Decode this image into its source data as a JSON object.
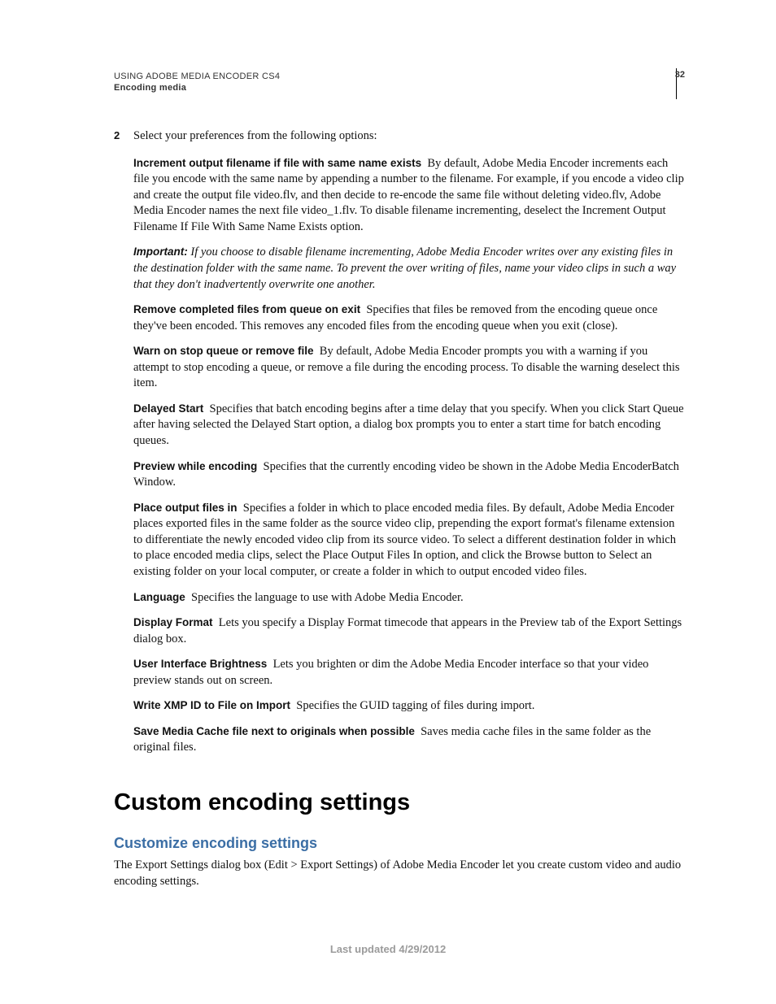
{
  "header": {
    "title": "USING ADOBE MEDIA ENCODER CS4",
    "subtitle": "Encoding media",
    "page_number": "32"
  },
  "step": {
    "number": "2",
    "text": "Select your preferences from the following options:"
  },
  "items": {
    "increment": {
      "term": "Increment output filename if file with same name exists",
      "body": "By default, Adobe Media Encoder increments each file you encode with the same name by appending a number to the filename. For example, if you encode a video clip and create the output file video.flv, and then decide to re-encode the same file without deleting video.flv, Adobe Media Encoder names the next file video_1.flv. To disable filename incrementing, deselect the Increment Output Filename If File With Same Name Exists option."
    },
    "important": {
      "lead": "Important:",
      "body": "If you choose to disable filename incrementing, Adobe Media Encoder writes over any existing files in the destination folder with the same name. To prevent the over writing of files, name your video clips in such a way that they don't inadvertently overwrite one another."
    },
    "remove": {
      "term": "Remove completed files from queue on exit",
      "body": "Specifies that files be removed from the encoding queue once they've been encoded. This removes any encoded files from the encoding queue when you exit (close)."
    },
    "warn": {
      "term": "Warn on stop queue or remove file",
      "body": "By default, Adobe Media Encoder prompts you with a warning if you attempt to stop encoding a queue, or remove a file during the encoding process. To disable the warning deselect this item."
    },
    "delayed": {
      "term": "Delayed Start",
      "body": "Specifies that batch encoding begins after a time delay that you specify. When you click Start Queue after having selected the Delayed Start option, a dialog box prompts you to enter a start time for batch encoding queues."
    },
    "preview": {
      "term": "Preview while encoding",
      "body": "Specifies that the currently encoding video be shown in the Adobe Media EncoderBatch Window."
    },
    "place": {
      "term": "Place output files in",
      "body": "Specifies a folder in which to place encoded media files. By default, Adobe Media Encoder places exported files in the same folder as the source video clip, prepending the export format's filename extension to differentiate the newly encoded video clip from its source video. To select a different destination folder in which to place encoded media clips, select the Place Output Files In option, and click the Browse button to Select an existing folder on your local computer, or create a folder in which to output encoded video files."
    },
    "language": {
      "term": "Language",
      "body": "Specifies the language to use with Adobe Media Encoder."
    },
    "display": {
      "term": "Display Format",
      "body": "Lets you specify a Display Format timecode that appears in the Preview tab of the Export Settings dialog box."
    },
    "brightness": {
      "term": "User Interface Brightness",
      "body": "Lets you brighten or dim the Adobe Media Encoder interface so that your video preview stands out on screen."
    },
    "xmp": {
      "term": "Write XMP ID to File on Import",
      "body": "Specifies the GUID tagging of files during import."
    },
    "cache": {
      "term": "Save Media Cache file next to originals when possible",
      "body": "Saves media cache files in the same folder as the original files."
    }
  },
  "section": {
    "h1": "Custom encoding settings",
    "h2": "Customize encoding settings",
    "intro": "The Export Settings dialog box (Edit > Export Settings) of Adobe Media Encoder let you create custom video and audio encoding settings."
  },
  "footer": "Last updated 4/29/2012"
}
